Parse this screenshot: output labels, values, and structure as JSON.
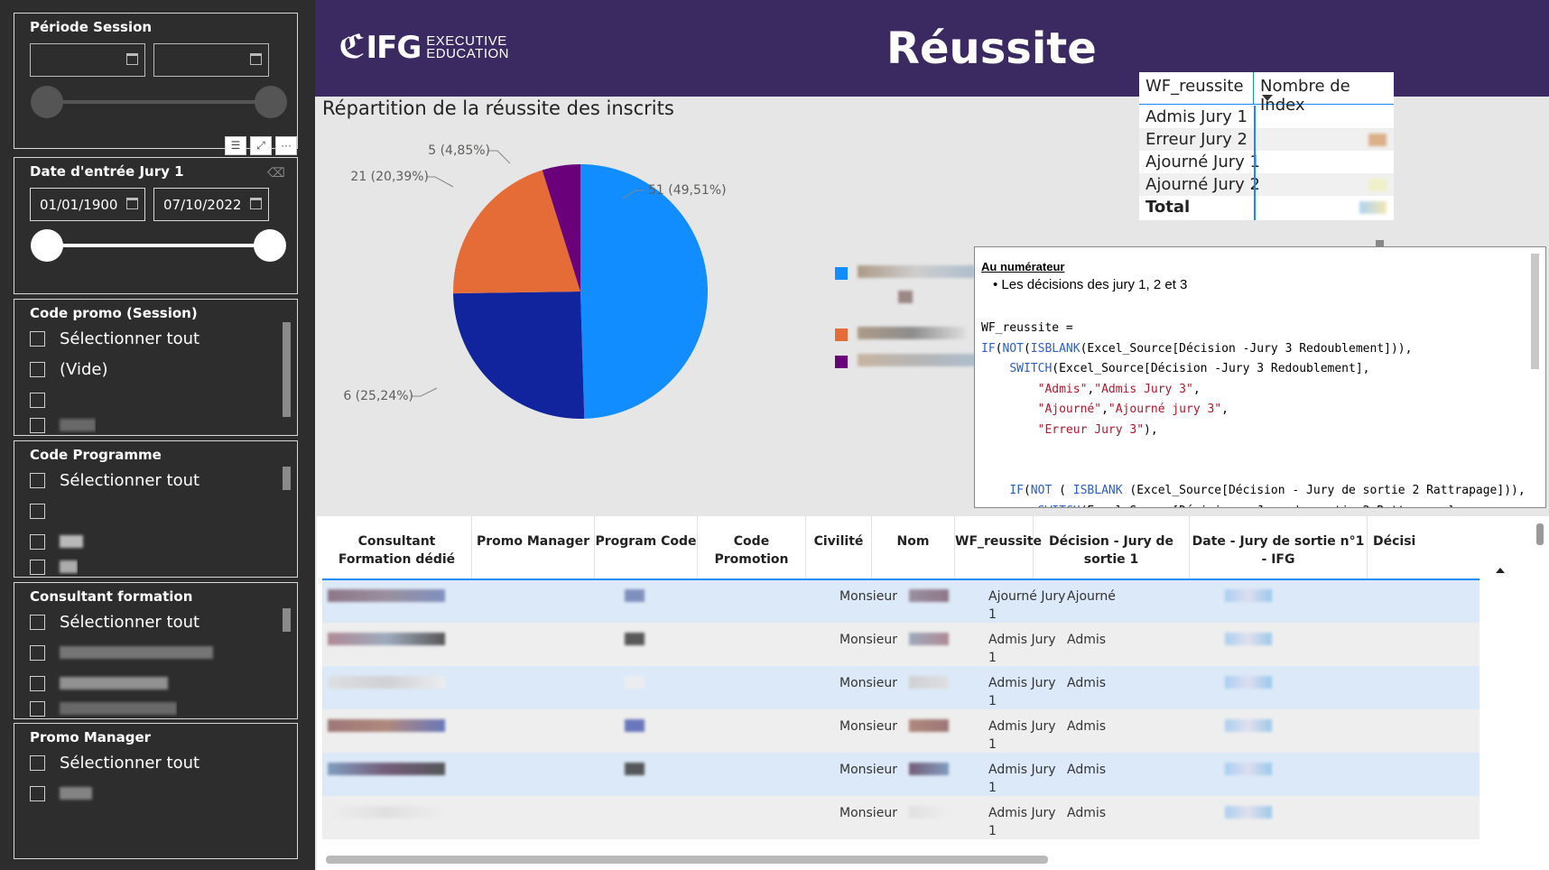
{
  "header": {
    "logo_mark": "IFG",
    "logo_line1": "EXECUTIVE",
    "logo_line2": "EDUCATION",
    "title": "Réussite"
  },
  "filters": {
    "periode_session": {
      "title": "Période Session",
      "start": "",
      "end": ""
    },
    "date_entree": {
      "title": "Date d'entrée Jury 1",
      "start": "01/01/1900",
      "end": "07/10/2022"
    },
    "code_promo": {
      "title": "Code promo (Session)",
      "items": [
        "Sélectionner tout",
        "(Vide)",
        "",
        ""
      ]
    },
    "code_programme": {
      "title": "Code Programme",
      "items": [
        "Sélectionner tout",
        "",
        "",
        ""
      ]
    },
    "consultant": {
      "title": "Consultant formation",
      "items": [
        "Sélectionner tout",
        "",
        "",
        ""
      ]
    },
    "promo_manager": {
      "title": "Promo Manager",
      "items": [
        "Sélectionner tout",
        ""
      ]
    }
  },
  "chart_data": {
    "type": "pie",
    "title": "Répartition de la réussite des inscrits",
    "slices": [
      {
        "label": "51 (49,51%)",
        "value": 51,
        "percent": 49.51,
        "color": "#118dff"
      },
      {
        "label": "26 (25,24%)",
        "value": 26,
        "percent": 25.24,
        "color": "#12239e"
      },
      {
        "label": "21 (20,39%)",
        "value": 21,
        "percent": 20.39,
        "color": "#e66c37"
      },
      {
        "label": "5 (4,85%)",
        "value": 5,
        "percent": 4.85,
        "color": "#6b007b"
      }
    ]
  },
  "matrix": {
    "col1": "WF_reussite",
    "col2": "Nombre de Index",
    "rows": [
      "Admis Jury 1",
      "Erreur Jury 2",
      "Ajourné Jury 1",
      "Ajourné Jury 2"
    ],
    "total": "Total"
  },
  "code_box": {
    "title": "Au numérateur ",
    "bullet": "Les décisions des jury 1, 2 et 3"
  },
  "table": {
    "columns": [
      "Consultant Formation dédié",
      "Promo Manager",
      "Program Code",
      "Code Promotion",
      "Civilité",
      "Nom",
      "WF_reussite",
      "Décision - Jury de sortie 1",
      "Date - Jury de sortie n°1 - IFG",
      "Décisi"
    ],
    "rows": [
      {
        "civilite": "Monsieur",
        "wf1": "Ajourné Jury",
        "wf2": "1",
        "decision": "Ajourné"
      },
      {
        "civilite": "Monsieur",
        "wf1": "Admis Jury",
        "wf2": "1",
        "decision": "Admis"
      },
      {
        "civilite": "Monsieur",
        "wf1": "Admis Jury",
        "wf2": "1",
        "decision": "Admis"
      },
      {
        "civilite": "Monsieur",
        "wf1": "Admis Jury",
        "wf2": "1",
        "decision": "Admis"
      },
      {
        "civilite": "Monsieur",
        "wf1": "Admis Jury",
        "wf2": "1",
        "decision": "Admis"
      },
      {
        "civilite": "Monsieur",
        "wf1": "Admis Jury",
        "wf2": "1",
        "decision": "Admis"
      }
    ]
  }
}
